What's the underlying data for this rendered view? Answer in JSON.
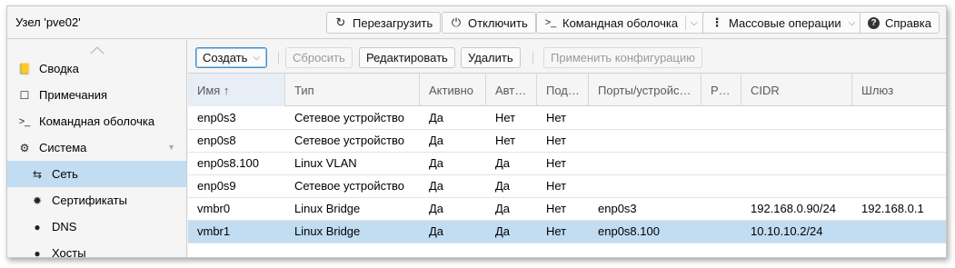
{
  "header": {
    "title": "Узел 'pve02'",
    "buttons": [
      {
        "id": "reboot",
        "icon": "reboot-icon",
        "label": "Перезагрузить"
      },
      {
        "id": "shutdown",
        "icon": "power-icon",
        "label": "Отключить"
      },
      {
        "id": "shell",
        "icon": "terminal-icon",
        "label": "Командная оболочка"
      },
      {
        "id": "bulk",
        "icon": "ellipsis-vertical-icon",
        "label": "Массовые операции"
      },
      {
        "id": "help",
        "icon": "question-circle-icon",
        "label": "Справка"
      }
    ]
  },
  "sidebar": {
    "items": [
      {
        "id": "summary",
        "icon": "book-icon",
        "label": "Сводка"
      },
      {
        "id": "notes",
        "icon": "note-icon",
        "label": "Примечания"
      },
      {
        "id": "shell",
        "icon": "terminal-icon",
        "label": "Командная оболочка"
      },
      {
        "id": "system",
        "icon": "cogs-icon",
        "label": "Система"
      },
      {
        "id": "network",
        "icon": "exchange-icon",
        "label": "Сеть",
        "selected": true
      },
      {
        "id": "certificates",
        "icon": "certificate-icon",
        "label": "Сертификаты"
      },
      {
        "id": "dns",
        "icon": "globe-icon",
        "label": "DNS"
      },
      {
        "id": "hosts",
        "icon": "globe-icon",
        "label": "Хосты"
      }
    ]
  },
  "toolbar": {
    "create_label": "Создать",
    "revert_label": "Сбросить",
    "edit_label": "Редактировать",
    "remove_label": "Удалить",
    "apply_label": "Применить конфигурацию"
  },
  "grid": {
    "columns": [
      "Имя ↑",
      "Тип",
      "Активно",
      "Авт…",
      "Под…",
      "Порты/устройс…",
      "Р…",
      "CIDR",
      "Шлюз"
    ],
    "rows": [
      [
        "enp0s3",
        "Сетевое устройство",
        "Да",
        "Нет",
        "Нет",
        "",
        "",
        "",
        ""
      ],
      [
        "enp0s8",
        "Сетевое устройство",
        "Да",
        "Нет",
        "Нет",
        "",
        "",
        "",
        ""
      ],
      [
        "enp0s8.100",
        "Linux VLAN",
        "Да",
        "Да",
        "Нет",
        "",
        "",
        "",
        ""
      ],
      [
        "enp0s9",
        "Сетевое устройство",
        "Да",
        "Да",
        "Нет",
        "",
        "",
        "",
        ""
      ],
      [
        "vmbr0",
        "Linux Bridge",
        "Да",
        "Да",
        "Нет",
        "enp0s3",
        "",
        "192.168.0.90/24",
        "192.168.0.1"
      ],
      [
        "vmbr1",
        "Linux Bridge",
        "Да",
        "Да",
        "Нет",
        "enp0s8.100",
        "",
        "10.10.10.2/24",
        ""
      ]
    ],
    "selected_row": 5
  },
  "colors": {
    "selection": "#c2ddf2",
    "primary_border": "#3e8fd1",
    "panel_bg": "#f5f5f5"
  }
}
